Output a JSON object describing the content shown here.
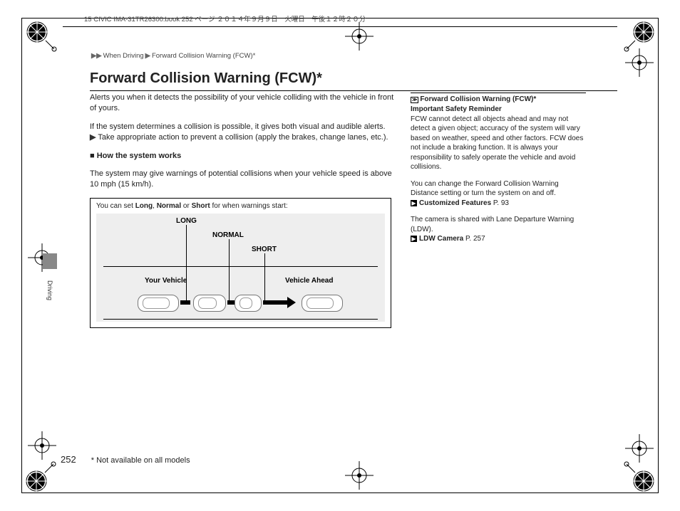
{
  "header": {
    "source_line": "15 CIVIC IMA-31TR26300.book  252 ページ  ２０１４年９月９日　火曜日　午後１２時２０分"
  },
  "breadcrumb": {
    "sep": "▶▶",
    "part1": "When Driving",
    "sep2": "▶",
    "part2": "Forward Collision Warning (FCW)*"
  },
  "title": "Forward Collision Warning (FCW)*",
  "main": {
    "p1": "Alerts you when it detects the possibility of your vehicle colliding with the vehicle in front of yours.",
    "p2": "If the system determines a collision is possible, it gives both visual and audible alerts.",
    "bullet_arrow": "▶",
    "bullet": "Take appropriate action to prevent a collision (apply the brakes, change lanes, etc.).",
    "subhead": "How the system works",
    "p3": "The system may give warnings of potential collisions when your vehicle speed is above 10 mph (15 km/h)."
  },
  "diagram": {
    "caption_pre": "You can set ",
    "opt1": "Long",
    "opt_sep1": ", ",
    "opt2": "Normal",
    "opt_sep2": " or ",
    "opt3": "Short",
    "caption_post": " for when warnings start:",
    "label_long": "LONG",
    "label_normal": "NORMAL",
    "label_short": "SHORT",
    "label_your": "Your Vehicle",
    "label_ahead": "Vehicle Ahead"
  },
  "reference": {
    "icon": "≫",
    "title": "Forward Collision Warning (FCW)*"
  },
  "sidebar": {
    "head1": "Important Safety Reminder",
    "p1": "FCW cannot detect all objects ahead and may not detect a given object; accuracy of the system will vary based on weather, speed and other factors. FCW does not include a braking function. It is always your responsibility to safely operate the vehicle and avoid collisions.",
    "p2": "You can change the Forward Collision Warning Distance setting or turn the system on and off.",
    "link1_label": "Customized Features",
    "link1_page": "P. 93",
    "p3": "The camera is shared with Lane Departure Warning (LDW).",
    "link2_label": "LDW Camera",
    "link2_page": "P. 257"
  },
  "tab": "Driving",
  "footer": {
    "page": "252",
    "note": "* Not available on all models"
  }
}
